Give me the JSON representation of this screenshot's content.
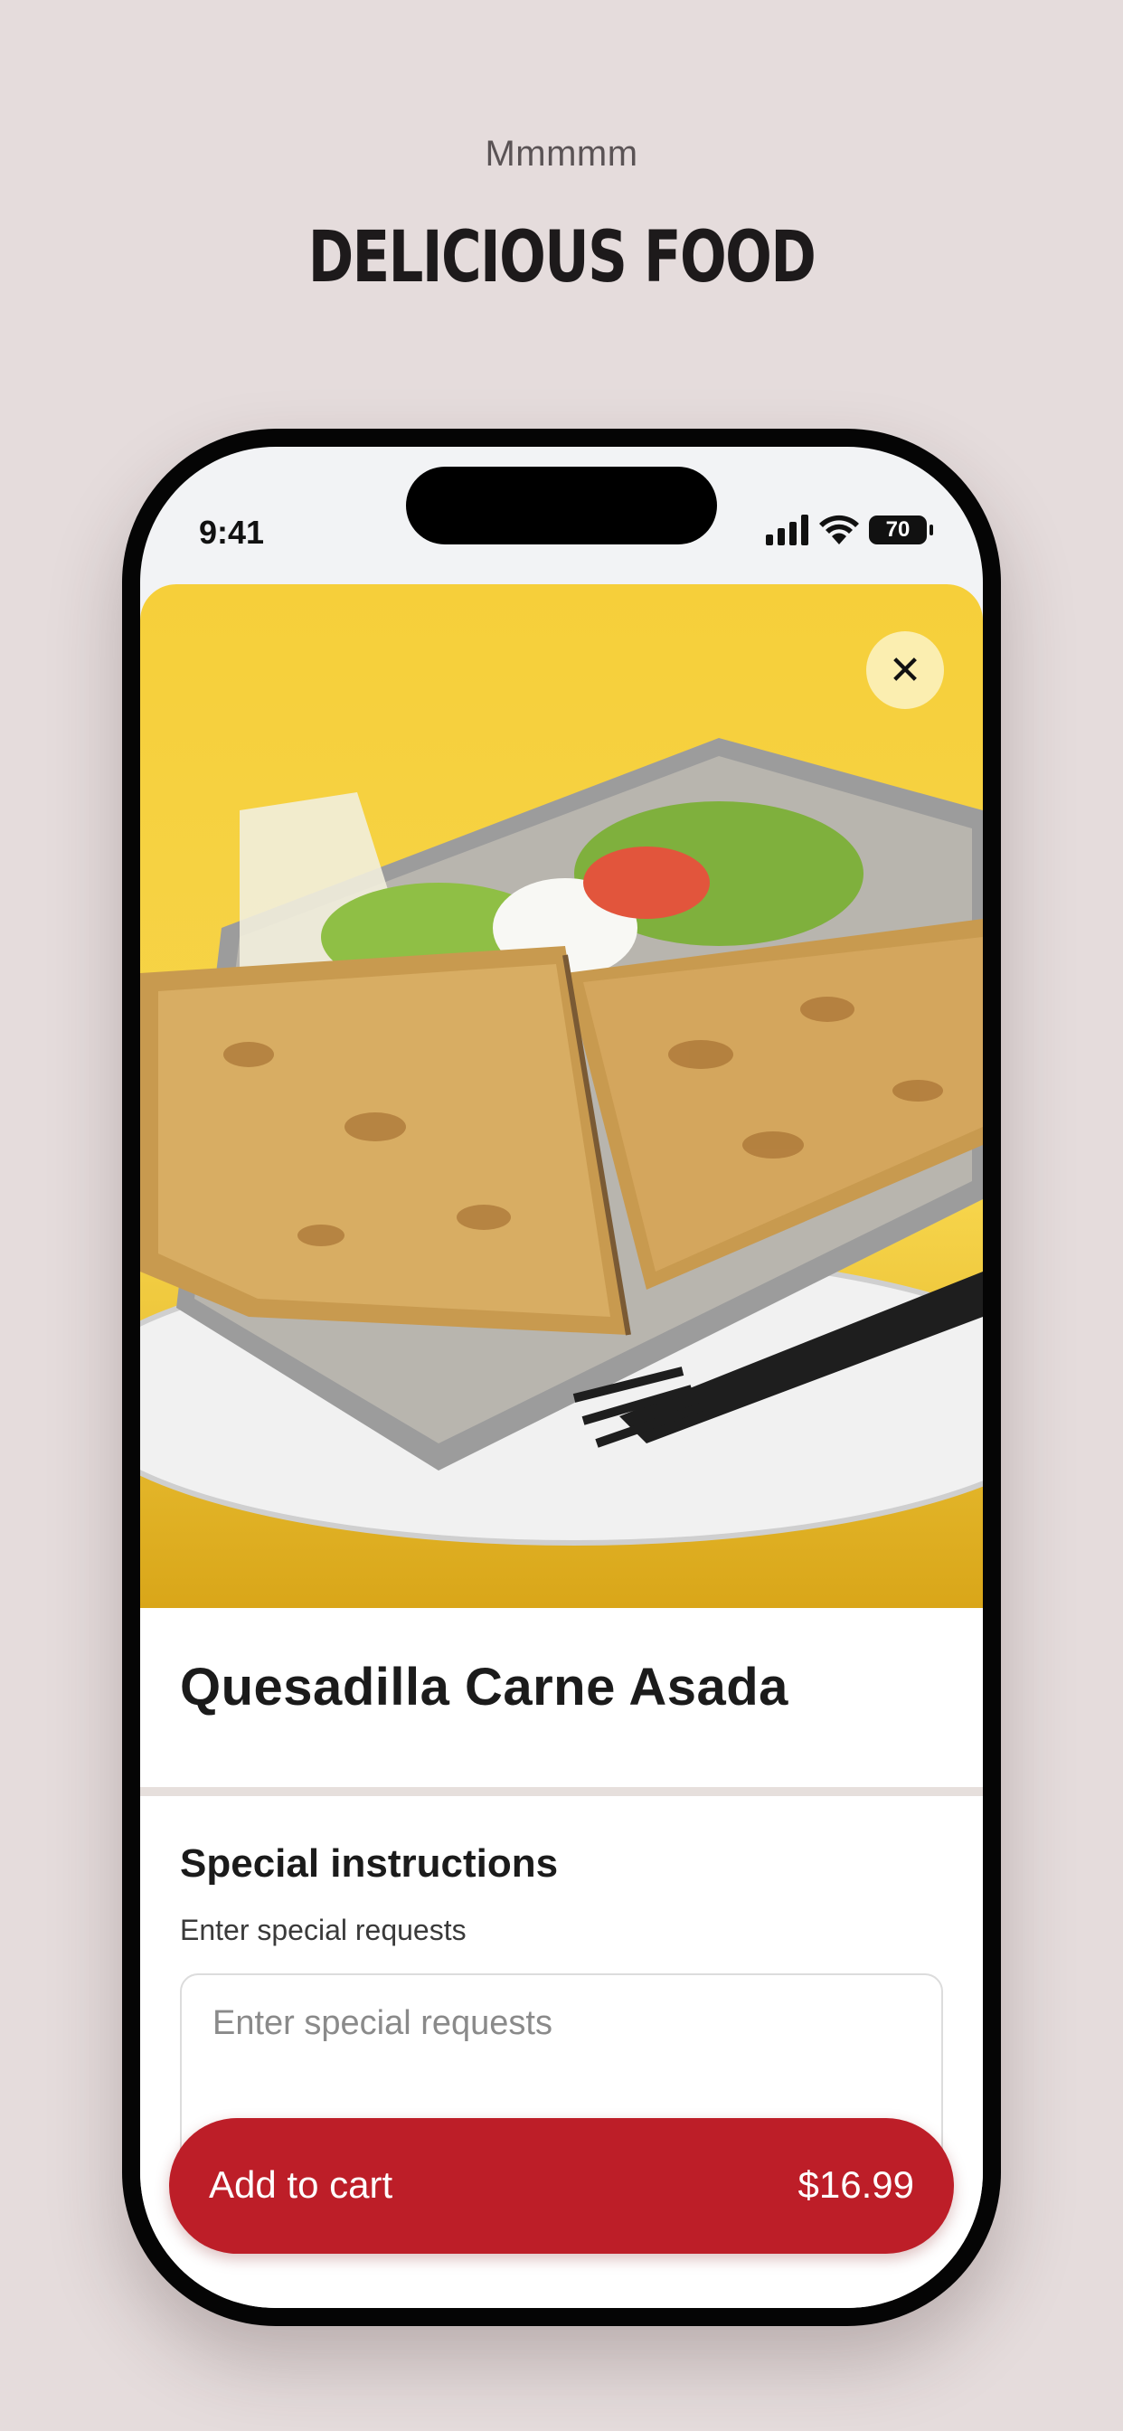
{
  "page": {
    "kicker": "Mmmmm",
    "headline": "DELICIOUS FOOD"
  },
  "status_bar": {
    "time": "9:41",
    "battery": "70"
  },
  "product": {
    "name": "Quesadilla Carne Asada",
    "image_icon": "food-photo"
  },
  "close": {
    "icon": "close-icon",
    "glyph": "✕"
  },
  "instructions": {
    "title": "Special instructions",
    "subtitle": "Enter special requests",
    "placeholder": "Enter special requests"
  },
  "cart": {
    "label": "Add to cart",
    "price": "$16.99"
  },
  "colors": {
    "accent": "#bd1e28",
    "background": "#e5dcdc",
    "hero": "#f6cf3a"
  }
}
